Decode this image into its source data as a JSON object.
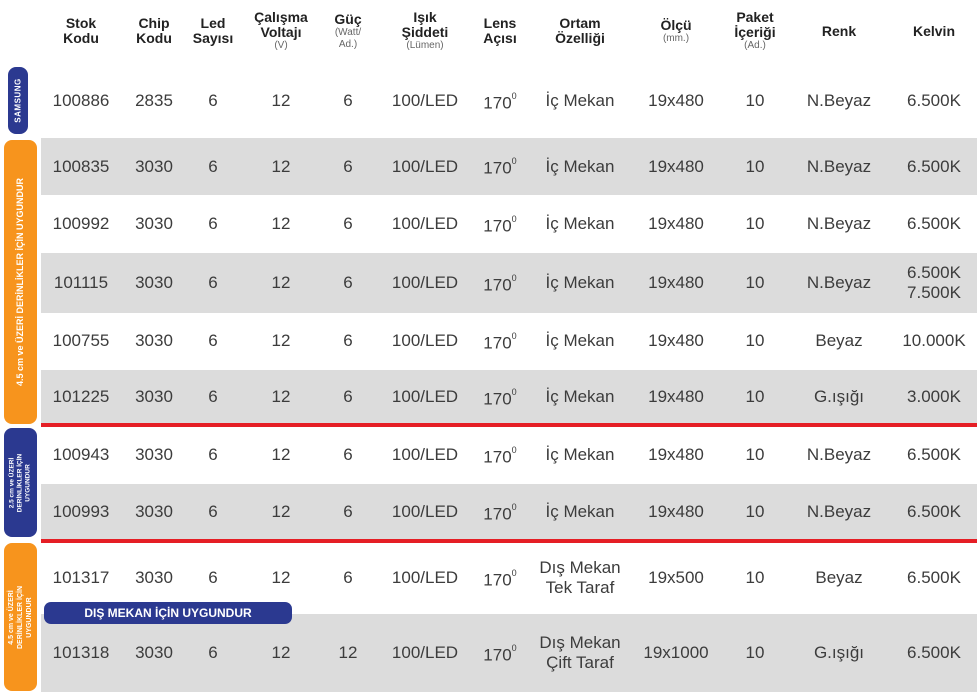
{
  "header": [
    {
      "label": "Stok\nKodu",
      "unit": ""
    },
    {
      "label": "Chip\nKodu",
      "unit": ""
    },
    {
      "label": "Led\nSayısı",
      "unit": ""
    },
    {
      "label": "Çalışma\nVoltajı",
      "unit": "(V)"
    },
    {
      "label": "Güç",
      "unit": "(Watt/\nAd.)"
    },
    {
      "label": "Işık\nŞiddeti",
      "unit": "(Lümen)"
    },
    {
      "label": "Lens\nAçısı",
      "unit": ""
    },
    {
      "label": "Ortam\nÖzelliği",
      "unit": ""
    },
    {
      "label": "Ölçü",
      "unit": "(mm.)"
    },
    {
      "label": "Paket\nİçeriği",
      "unit": "(Ad.)"
    },
    {
      "label": "Renk",
      "unit": ""
    },
    {
      "label": "Kelvin",
      "unit": ""
    }
  ],
  "rows": [
    [
      "100886",
      "2835",
      "6",
      "12",
      "6",
      "100/LED",
      "170",
      "İç Mekan",
      "19x480",
      "10",
      "N.Beyaz",
      "6.500K"
    ],
    [
      "100835",
      "3030",
      "6",
      "12",
      "6",
      "100/LED",
      "170",
      "İç Mekan",
      "19x480",
      "10",
      "N.Beyaz",
      "6.500K"
    ],
    [
      "100992",
      "3030",
      "6",
      "12",
      "6",
      "100/LED",
      "170",
      "İç Mekan",
      "19x480",
      "10",
      "N.Beyaz",
      "6.500K"
    ],
    [
      "101115",
      "3030",
      "6",
      "12",
      "6",
      "100/LED",
      "170",
      "İç Mekan",
      "19x480",
      "10",
      "N.Beyaz",
      "6.500K\n7.500K"
    ],
    [
      "100755",
      "3030",
      "6",
      "12",
      "6",
      "100/LED",
      "170",
      "İç Mekan",
      "19x480",
      "10",
      "Beyaz",
      "10.000K"
    ],
    [
      "101225",
      "3030",
      "6",
      "12",
      "6",
      "100/LED",
      "170",
      "İç Mekan",
      "19x480",
      "10",
      "G.ışığı",
      "3.000K"
    ],
    [
      "100943",
      "3030",
      "6",
      "12",
      "6",
      "100/LED",
      "170",
      "İç Mekan",
      "19x480",
      "10",
      "N.Beyaz",
      "6.500K"
    ],
    [
      "100993",
      "3030",
      "6",
      "12",
      "6",
      "100/LED",
      "170",
      "İç Mekan",
      "19x480",
      "10",
      "N.Beyaz",
      "6.500K"
    ],
    [
      "101317",
      "3030",
      "6",
      "12",
      "6",
      "100/LED",
      "170",
      "Dış Mekan\nTek Taraf",
      "19x500",
      "10",
      "Beyaz",
      "6.500K"
    ],
    [
      "101318",
      "3030",
      "6",
      "12",
      "12",
      "100/LED",
      "170",
      "Dış Mekan\nÇift Taraf",
      "19x1000",
      "10",
      "G.ışığı",
      "6.500K"
    ]
  ],
  "lens_degree_mark": "0",
  "groups": {
    "samsung": "SAMSUNG",
    "group1": "4.5 cm ve ÜZERİ DERİNLİKLER İÇİN UYGUNDUR",
    "group2": "2.5 cm ve ÜZERİ\nDERİNLİKLER İÇİN\nUYGUNDUR",
    "group3": "4.5 cm ve ÜZERİ\nDERİNLİKLER İÇİN\nUYGUNDUR"
  },
  "outdoor_badge": "DIŞ MEKAN İÇİN UYGUNDUR",
  "colors": {
    "navy": "#2b3990",
    "orange": "#f7941d",
    "red": "#e51e25",
    "shade": "#dcdcdc"
  }
}
